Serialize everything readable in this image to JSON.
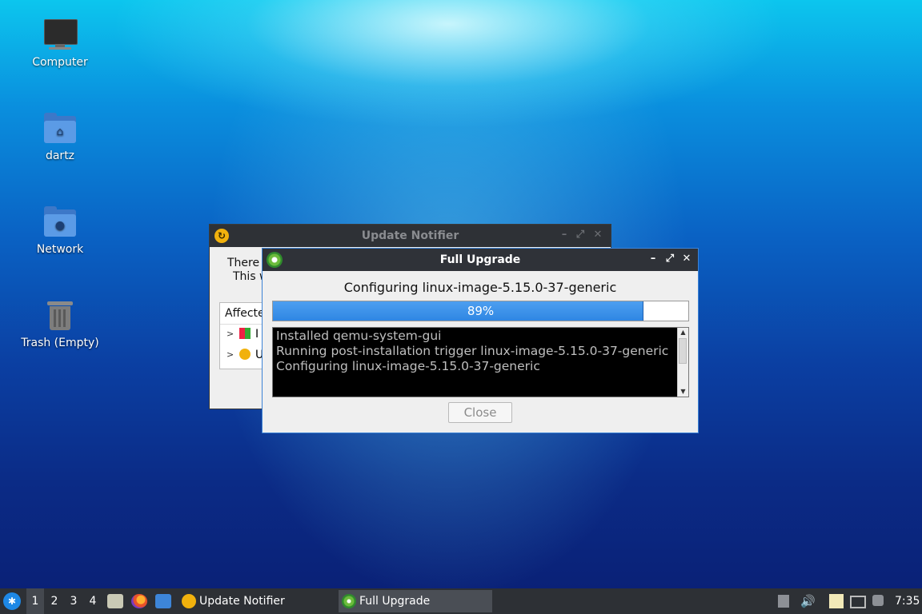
{
  "desktop": {
    "icons": [
      {
        "label": "Computer",
        "icon": "computer-icon"
      },
      {
        "label": "dartz",
        "icon": "home-folder-icon"
      },
      {
        "label": "Network",
        "icon": "network-folder-icon"
      },
      {
        "label": "Trash (Empty)",
        "icon": "trash-icon"
      }
    ]
  },
  "update_notifier": {
    "title": "Update Notifier",
    "body_line1": "There",
    "body_line2": "This w",
    "affected_label": "Affecte",
    "tree_item1": "I",
    "tree_item2": "U"
  },
  "full_upgrade": {
    "title": "Full Upgrade",
    "status": "Configuring linux-image-5.15.0-37-generic",
    "progress_percent": 89,
    "progress_label": "89%",
    "log_lines": [
      "Installed qemu-system-gui",
      "Running post-installation trigger linux-image-5.15.0-37-generic",
      "Configuring linux-image-5.15.0-37-generic"
    ],
    "close_label": "Close"
  },
  "taskbar": {
    "workspaces": [
      "1",
      "2",
      "3",
      "4"
    ],
    "active_workspace": "1",
    "tasks": [
      {
        "label": "Update Notifier",
        "icon": "update-notifier-icon",
        "active": false
      },
      {
        "label": "Full Upgrade",
        "icon": "gear-icon",
        "active": true
      }
    ],
    "clock": "7:35"
  },
  "colors": {
    "accent": "#3c83d6",
    "progress": "#2f86e3",
    "taskbar": "#2d3035"
  }
}
